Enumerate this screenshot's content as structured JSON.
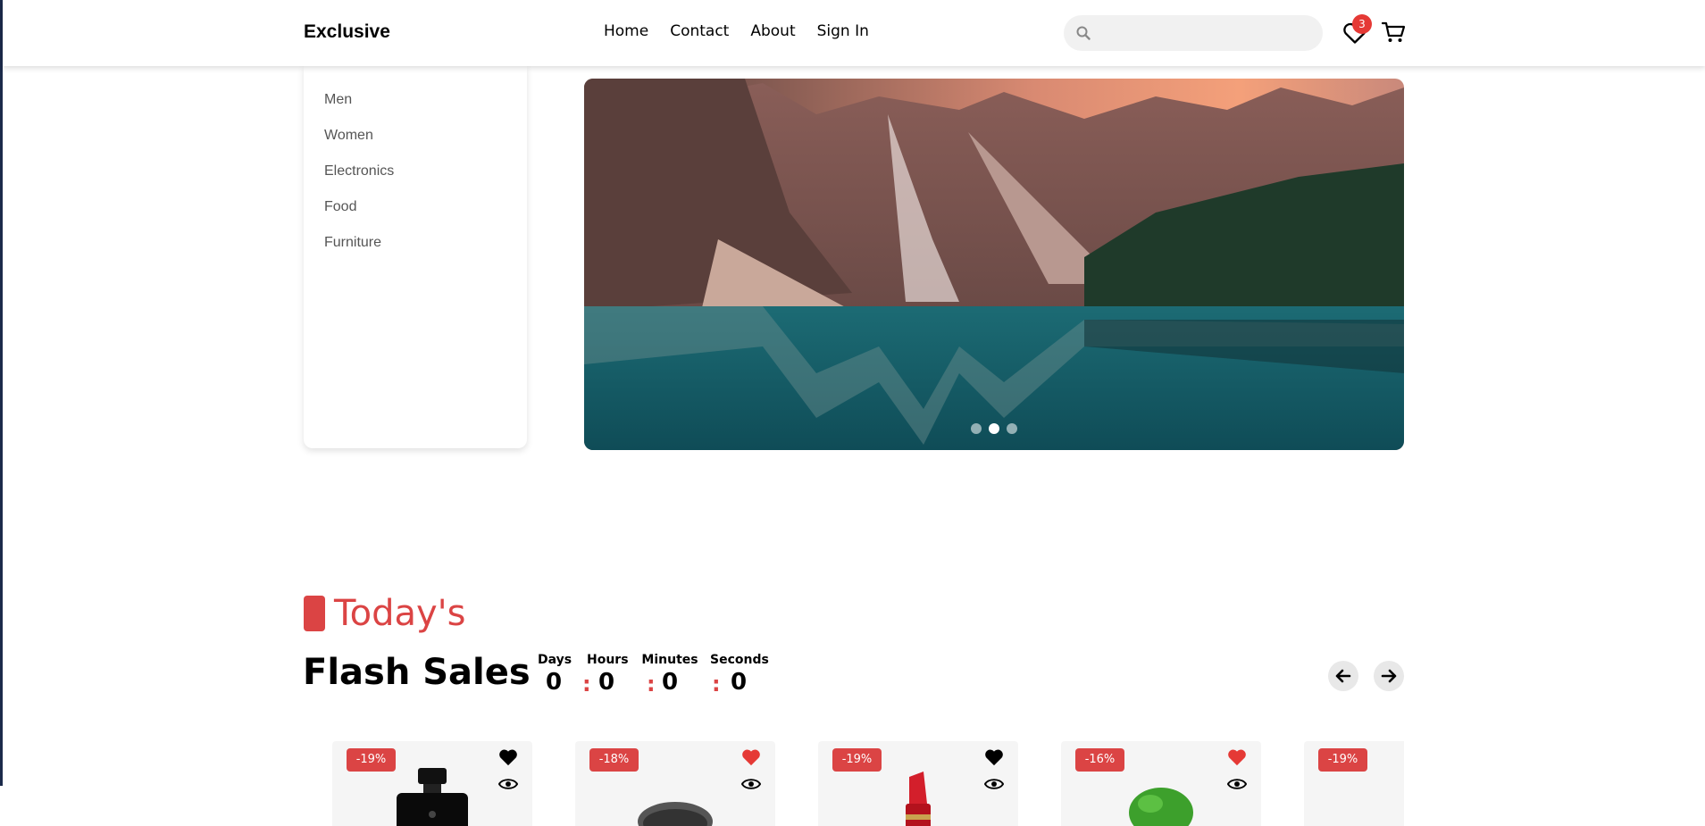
{
  "header": {
    "logo": "Exclusive",
    "nav": [
      "Home",
      "Contact",
      "About",
      "Sign In"
    ],
    "search_placeholder": "",
    "wishlist_count": "3"
  },
  "categories": [
    "Men",
    "Women",
    "Electronics",
    "Food",
    "Furniture"
  ],
  "hero": {
    "slide_count": 3,
    "active_slide": 2,
    "image": "mountain-lake-landscape"
  },
  "flash": {
    "section_label": "Today's",
    "title": "Flash Sales",
    "countdown": {
      "days_label": "Days",
      "days": "0",
      "hours_label": "Hours",
      "hours": "0",
      "minutes_label": "Minutes",
      "minutes": "0",
      "seconds_label": "Seconds",
      "seconds": "0"
    }
  },
  "products": [
    {
      "discount": "-19%",
      "favorited": false,
      "product": "perfume-bottle"
    },
    {
      "discount": "-18%",
      "favorited": true,
      "product": "dark-round-item"
    },
    {
      "discount": "-19%",
      "favorited": false,
      "product": "red-lipstick"
    },
    {
      "discount": "-16%",
      "favorited": true,
      "product": "green-vegetable"
    },
    {
      "discount": "-19%",
      "favorited": false,
      "product": "unknown"
    }
  ],
  "colors": {
    "accent": "#db4444",
    "badge": "#e53935",
    "heart_active": "#e53935",
    "heart_inactive": "#000000"
  }
}
